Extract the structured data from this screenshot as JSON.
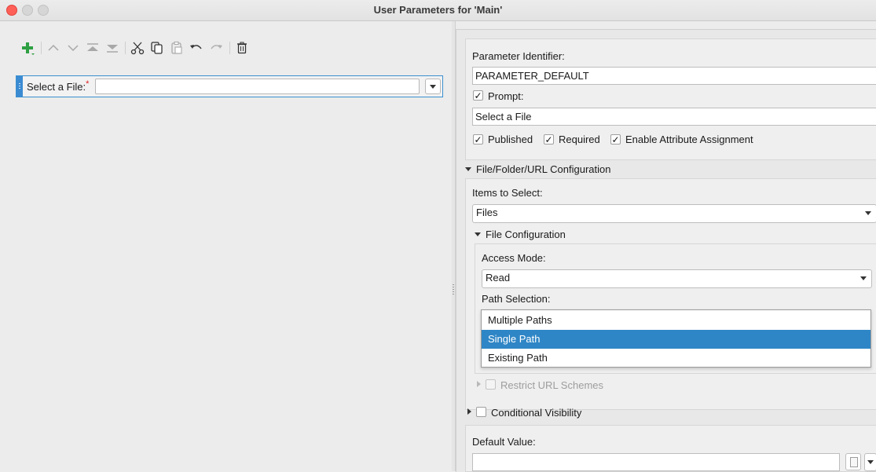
{
  "window": {
    "title": "User Parameters for 'Main'"
  },
  "toolbar": {
    "icons": [
      "add-icon",
      "move-up-icon",
      "move-down-icon",
      "move-top-icon",
      "move-bottom-icon",
      "cut-icon",
      "copy-icon",
      "paste-icon",
      "undo-icon",
      "redo-icon",
      "delete-icon"
    ]
  },
  "param_list": {
    "row_label": "Select a File:",
    "required_marker": "*",
    "value": ""
  },
  "props": {
    "identifier_label": "Parameter Identifier:",
    "identifier_value": "PARAMETER_DEFAULT",
    "prompt_checkbox_label": "Prompt:",
    "prompt_checked": true,
    "prompt_value": "Select a File",
    "published_label": "Published",
    "published_checked": true,
    "required_label": "Required",
    "required_checked": true,
    "attr_assign_label": "Enable Attribute Assignment",
    "attr_assign_checked": true,
    "check_mark": "✓",
    "file_url_section": "File/Folder/URL Configuration",
    "items_to_select_label": "Items to Select:",
    "items_to_select_value": "Files",
    "file_config_section": "File Configuration",
    "access_mode_label": "Access Mode:",
    "access_mode_value": "Read",
    "path_selection_label": "Path Selection:",
    "path_selection_options": [
      "Multiple Paths",
      "Single Path",
      "Existing Path"
    ],
    "path_selection_selected": "Single Path",
    "restrict_url_label": "Restrict URL Schemes",
    "restrict_url_checked": false,
    "conditional_visibility_label": "Conditional Visibility",
    "conditional_visibility_checked": false,
    "default_value_label": "Default Value:",
    "default_value": ""
  },
  "colors": {
    "selection_blue": "#2f86c6",
    "accent_blue": "#3a8fd0",
    "required_red": "#e02020",
    "add_green": "#2ea043",
    "close_red": "#fe5f57"
  }
}
